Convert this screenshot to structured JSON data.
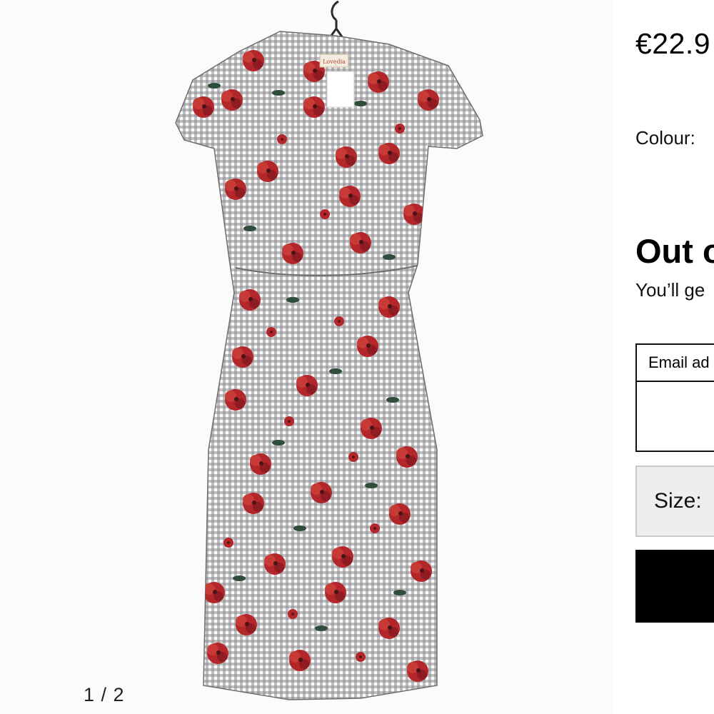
{
  "gallery": {
    "counter": "1 / 2"
  },
  "product": {
    "price": "€22.9",
    "colour_label": "Colour:",
    "stock_title": "Out o",
    "stock_subtitle": "You’ll ge"
  },
  "notify_form": {
    "email_label": "Email ad",
    "email_value": "",
    "size_label": "Size:",
    "submit_label": ""
  },
  "dress_label_text": "Lovedia",
  "colors": {
    "background": "#ffffff",
    "gallery_background": "#fbfbfa",
    "button": "#000000",
    "size_select_background": "#eeeeee",
    "dress_flower_red": "#b3262a",
    "dress_leaf_green": "#2f4d3a"
  }
}
